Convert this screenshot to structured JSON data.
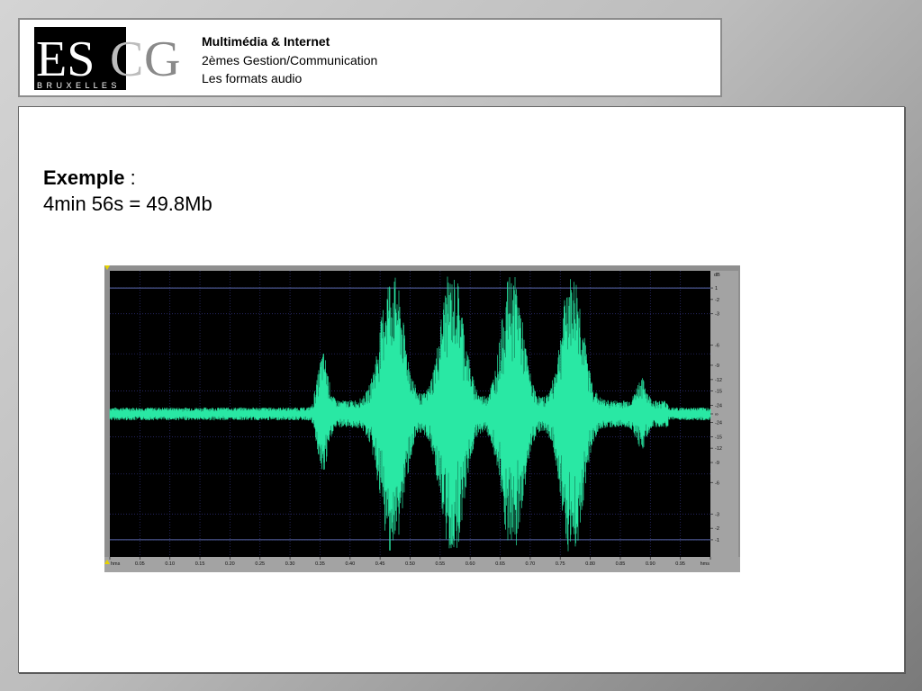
{
  "header": {
    "logo": {
      "text_left": "ES",
      "text_c": "C",
      "text_g": "G",
      "subtitle": "B R U X E L L E S",
      "colors": {
        "black": "#000000",
        "grey": "#8a8a8a",
        "silver": "#bcbcbc"
      }
    },
    "line1": "Multimédia & Internet",
    "line2": "2èmes Gestion/Communication",
    "line3": "Les formats audio"
  },
  "content": {
    "example_label": "Exemple",
    "example_colon": " :",
    "example_value": "4min 56s = 49.8Mb"
  },
  "waveform": {
    "wave_color": "#29e8a4",
    "x_ticks": [
      "hms",
      "0.05",
      "0.10",
      "0.15",
      "0.20",
      "0.25",
      "0.30",
      "0.35",
      "0.40",
      "0.45",
      "0.50",
      "0.55",
      "0.60",
      "0.65",
      "0.70",
      "0.75",
      "0.80",
      "0.85",
      "0.90",
      "0.95",
      "hms"
    ],
    "db_unit": "dB",
    "db_ticks": [
      "1",
      "-2",
      "-3",
      "-6",
      "-9",
      "-12",
      "-15",
      "-24",
      "∞",
      "-24",
      "-15",
      "-12",
      "-9",
      "-6",
      "-3",
      "-2",
      "-1"
    ]
  }
}
